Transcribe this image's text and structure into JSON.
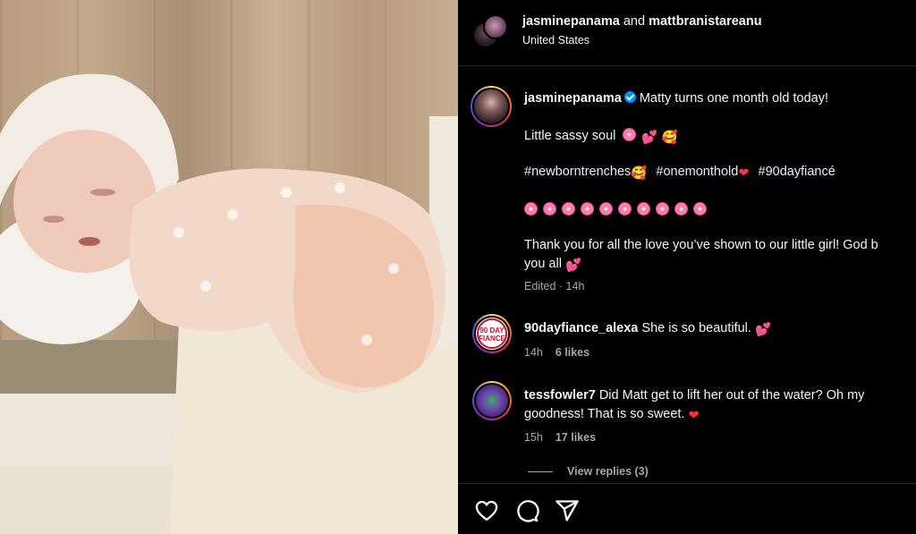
{
  "header": {
    "user1": "jasminepanama",
    "conjunction": "and",
    "user2": "mattbranistareanu",
    "location": "United States"
  },
  "caption": {
    "username": "jasminepanama",
    "line1": "Matty turns one month old today!",
    "line2": "Little sassy soul",
    "hashtag1": "#newborntrenches",
    "hashtag2": "#onemonthold",
    "hashtag3": "#90dayfiancé",
    "line4a": "Thank you for all the love you’ve shown to our little girl! God b",
    "line4b": "you all",
    "edited": "Edited · 14h"
  },
  "comments": [
    {
      "username": "90dayfiance_alexa",
      "text": "She is so beautiful.",
      "time": "14h",
      "likes": "6 likes",
      "avatar_text": "90 DAY FIANCE"
    },
    {
      "username": "tessfowler7",
      "text_line1": "Did Matt get to lift her out of the water? Oh my",
      "text_line2": "goodness! That is so sweet.",
      "time": "15h",
      "likes": "17 likes"
    }
  ],
  "view_replies": "View replies (3)",
  "icons": {
    "like": "heart-icon",
    "comment": "comment-icon",
    "share": "send-icon"
  },
  "colors": {
    "background": "#000000",
    "text": "#f5f5f5",
    "muted": "#a8a8a8",
    "verified": "#0095f6",
    "hashtag": "#e0f1ff"
  }
}
